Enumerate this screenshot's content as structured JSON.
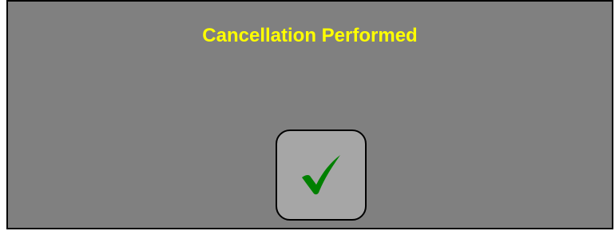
{
  "dialog": {
    "title": "Cancellation Performed",
    "title_color": "#ffff00",
    "background_color": "#808080",
    "confirm_button": {
      "icon": "checkmark-icon",
      "icon_color": "#008000",
      "background_color": "#a6a6a6"
    }
  }
}
